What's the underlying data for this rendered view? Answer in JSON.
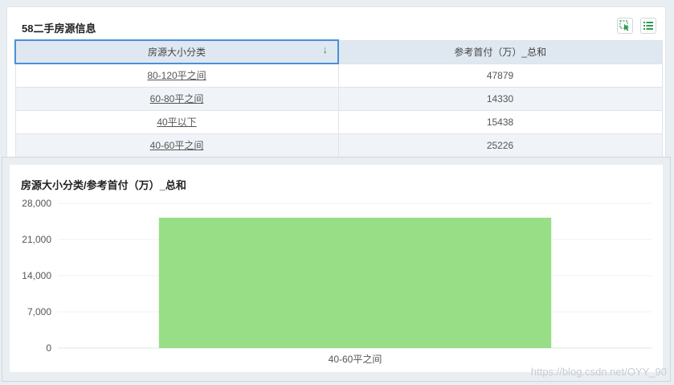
{
  "panel": {
    "title": "58二手房源信息"
  },
  "toolbar": {
    "select_icon": "cursor-select-icon",
    "list_icon": "list-view-icon",
    "accent_color": "#2e9b4f"
  },
  "table": {
    "columns": [
      "房源大小分类",
      "参考首付（万）_总和"
    ],
    "sort_icon": "sort-down-arrow-icon",
    "rows": [
      {
        "category": "80-120平之间",
        "value": "47879"
      },
      {
        "category": "60-80平之间",
        "value": "14330"
      },
      {
        "category": "40平以下",
        "value": "15438"
      },
      {
        "category": "40-60平之间",
        "value": "25226"
      }
    ]
  },
  "chart": {
    "title": "房源大小分类/参考首付（万）_总和"
  },
  "chart_data": {
    "type": "bar",
    "title": "房源大小分类/参考首付（万）_总和",
    "categories": [
      "40-60平之间"
    ],
    "values": [
      25226
    ],
    "ylim": [
      0,
      28000
    ],
    "yticks": [
      "28,000",
      "21,000",
      "14,000",
      "7,000",
      "0"
    ],
    "ytick_values": [
      28000,
      21000,
      14000,
      7000,
      0
    ],
    "bar_color": "#98de86",
    "grid": true
  },
  "watermark": "https://blog.csdn.net/OYY_90"
}
